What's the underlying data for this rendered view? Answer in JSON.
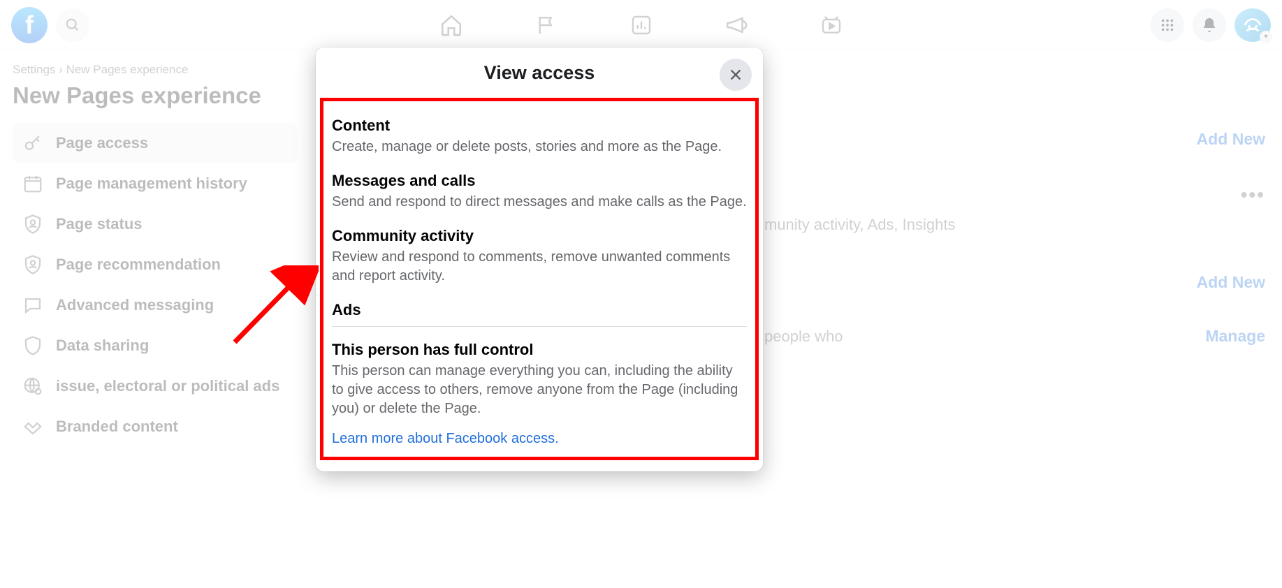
{
  "header": {
    "nav_icons": [
      "home-icon",
      "flag-icon",
      "dashboard-icon",
      "megaphone-icon",
      "video-icon"
    ]
  },
  "breadcrumb": {
    "root": "Settings",
    "sep": "›",
    "leaf": "New Pages experience"
  },
  "page_title": "New Pages experience",
  "sidebar": {
    "items": [
      {
        "label": "Page access",
        "active": true
      },
      {
        "label": "Page management history",
        "active": false
      },
      {
        "label": "Page status",
        "active": false
      },
      {
        "label": "Page recommendation",
        "active": false
      },
      {
        "label": "Advanced messaging",
        "active": false
      },
      {
        "label": "Data sharing",
        "active": false
      },
      {
        "label": "issue, electoral or political ads",
        "active": false
      },
      {
        "label": "Branded content",
        "active": false
      }
    ]
  },
  "main": {
    "add_new_1": "Add New",
    "bg_line": "munity activity, Ads, Insights",
    "add_new_2": "Add New",
    "bg_line2": "people who",
    "manage": "Manage"
  },
  "modal": {
    "title": "View access",
    "sections": [
      {
        "title": "Content",
        "desc": "Create, manage or delete posts, stories and more as the Page."
      },
      {
        "title": "Messages and calls",
        "desc": "Send and respond to direct messages and make calls as the Page."
      },
      {
        "title": "Community activity",
        "desc": "Review and respond to comments, remove unwanted comments and report activity."
      },
      {
        "title": "Ads",
        "desc": ""
      }
    ],
    "full_control": {
      "title": "This person has full control",
      "desc": "This person can manage everything you can, including the ability to give access to others, remove anyone from the Page (including you) or delete the Page."
    },
    "learn_more": "Learn more about Facebook access."
  }
}
